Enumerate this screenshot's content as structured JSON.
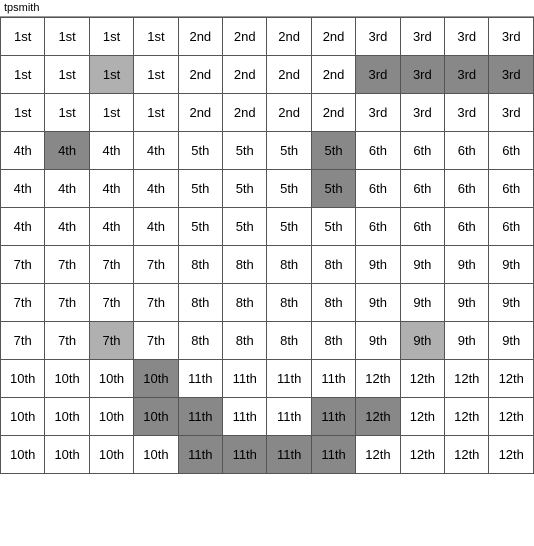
{
  "title": "tpsmith",
  "grid": {
    "rows": [
      [
        {
          "text": "1st",
          "bg": "normal"
        },
        {
          "text": "1st",
          "bg": "normal"
        },
        {
          "text": "1st",
          "bg": "normal"
        },
        {
          "text": "1st",
          "bg": "normal"
        },
        {
          "text": "2nd",
          "bg": "normal"
        },
        {
          "text": "2nd",
          "bg": "normal"
        },
        {
          "text": "2nd",
          "bg": "normal"
        },
        {
          "text": "2nd",
          "bg": "normal"
        },
        {
          "text": "3rd",
          "bg": "normal"
        },
        {
          "text": "3rd",
          "bg": "normal"
        },
        {
          "text": "3rd",
          "bg": "normal"
        },
        {
          "text": "3rd",
          "bg": "normal"
        }
      ],
      [
        {
          "text": "1st",
          "bg": "normal"
        },
        {
          "text": "1st",
          "bg": "normal"
        },
        {
          "text": "1st",
          "bg": "highlight"
        },
        {
          "text": "1st",
          "bg": "normal"
        },
        {
          "text": "2nd",
          "bg": "normal"
        },
        {
          "text": "2nd",
          "bg": "normal"
        },
        {
          "text": "2nd",
          "bg": "normal"
        },
        {
          "text": "2nd",
          "bg": "normal"
        },
        {
          "text": "3rd",
          "bg": "dark-highlight"
        },
        {
          "text": "3rd",
          "bg": "dark-highlight"
        },
        {
          "text": "3rd",
          "bg": "dark-highlight"
        },
        {
          "text": "3rd",
          "bg": "dark-highlight"
        }
      ],
      [
        {
          "text": "1st",
          "bg": "normal"
        },
        {
          "text": "1st",
          "bg": "normal"
        },
        {
          "text": "1st",
          "bg": "normal"
        },
        {
          "text": "1st",
          "bg": "normal"
        },
        {
          "text": "2nd",
          "bg": "normal"
        },
        {
          "text": "2nd",
          "bg": "normal"
        },
        {
          "text": "2nd",
          "bg": "normal"
        },
        {
          "text": "2nd",
          "bg": "normal"
        },
        {
          "text": "3rd",
          "bg": "normal"
        },
        {
          "text": "3rd",
          "bg": "normal"
        },
        {
          "text": "3rd",
          "bg": "normal"
        },
        {
          "text": "3rd",
          "bg": "normal"
        }
      ],
      [
        {
          "text": "4th",
          "bg": "normal"
        },
        {
          "text": "4th",
          "bg": "dark-highlight"
        },
        {
          "text": "4th",
          "bg": "normal"
        },
        {
          "text": "4th",
          "bg": "normal"
        },
        {
          "text": "5th",
          "bg": "normal"
        },
        {
          "text": "5th",
          "bg": "normal"
        },
        {
          "text": "5th",
          "bg": "normal"
        },
        {
          "text": "5th",
          "bg": "dark-highlight"
        },
        {
          "text": "6th",
          "bg": "normal"
        },
        {
          "text": "6th",
          "bg": "normal"
        },
        {
          "text": "6th",
          "bg": "normal"
        },
        {
          "text": "6th",
          "bg": "normal"
        }
      ],
      [
        {
          "text": "4th",
          "bg": "normal"
        },
        {
          "text": "4th",
          "bg": "normal"
        },
        {
          "text": "4th",
          "bg": "normal"
        },
        {
          "text": "4th",
          "bg": "normal"
        },
        {
          "text": "5th",
          "bg": "normal"
        },
        {
          "text": "5th",
          "bg": "normal"
        },
        {
          "text": "5th",
          "bg": "normal"
        },
        {
          "text": "5th",
          "bg": "dark-highlight"
        },
        {
          "text": "6th",
          "bg": "normal"
        },
        {
          "text": "6th",
          "bg": "normal"
        },
        {
          "text": "6th",
          "bg": "normal"
        },
        {
          "text": "6th",
          "bg": "normal"
        }
      ],
      [
        {
          "text": "4th",
          "bg": "normal"
        },
        {
          "text": "4th",
          "bg": "normal"
        },
        {
          "text": "4th",
          "bg": "normal"
        },
        {
          "text": "4th",
          "bg": "normal"
        },
        {
          "text": "5th",
          "bg": "normal"
        },
        {
          "text": "5th",
          "bg": "normal"
        },
        {
          "text": "5th",
          "bg": "normal"
        },
        {
          "text": "5th",
          "bg": "normal"
        },
        {
          "text": "6th",
          "bg": "normal"
        },
        {
          "text": "6th",
          "bg": "normal"
        },
        {
          "text": "6th",
          "bg": "normal"
        },
        {
          "text": "6th",
          "bg": "normal"
        }
      ],
      [
        {
          "text": "7th",
          "bg": "normal"
        },
        {
          "text": "7th",
          "bg": "normal"
        },
        {
          "text": "7th",
          "bg": "normal"
        },
        {
          "text": "7th",
          "bg": "normal"
        },
        {
          "text": "8th",
          "bg": "normal"
        },
        {
          "text": "8th",
          "bg": "normal"
        },
        {
          "text": "8th",
          "bg": "normal"
        },
        {
          "text": "8th",
          "bg": "normal"
        },
        {
          "text": "9th",
          "bg": "normal"
        },
        {
          "text": "9th",
          "bg": "normal"
        },
        {
          "text": "9th",
          "bg": "normal"
        },
        {
          "text": "9th",
          "bg": "normal"
        }
      ],
      [
        {
          "text": "7th",
          "bg": "normal"
        },
        {
          "text": "7th",
          "bg": "normal"
        },
        {
          "text": "7th",
          "bg": "normal"
        },
        {
          "text": "7th",
          "bg": "normal"
        },
        {
          "text": "8th",
          "bg": "normal"
        },
        {
          "text": "8th",
          "bg": "normal"
        },
        {
          "text": "8th",
          "bg": "normal"
        },
        {
          "text": "8th",
          "bg": "normal"
        },
        {
          "text": "9th",
          "bg": "normal"
        },
        {
          "text": "9th",
          "bg": "normal"
        },
        {
          "text": "9th",
          "bg": "normal"
        },
        {
          "text": "9th",
          "bg": "normal"
        }
      ],
      [
        {
          "text": "7th",
          "bg": "normal"
        },
        {
          "text": "7th",
          "bg": "normal"
        },
        {
          "text": "7th",
          "bg": "highlight"
        },
        {
          "text": "7th",
          "bg": "normal"
        },
        {
          "text": "8th",
          "bg": "normal"
        },
        {
          "text": "8th",
          "bg": "normal"
        },
        {
          "text": "8th",
          "bg": "normal"
        },
        {
          "text": "8th",
          "bg": "normal"
        },
        {
          "text": "9th",
          "bg": "normal"
        },
        {
          "text": "9th",
          "bg": "highlight"
        },
        {
          "text": "9th",
          "bg": "normal"
        },
        {
          "text": "9th",
          "bg": "normal"
        }
      ],
      [
        {
          "text": "10th",
          "bg": "normal"
        },
        {
          "text": "10th",
          "bg": "normal"
        },
        {
          "text": "10th",
          "bg": "normal"
        },
        {
          "text": "10th",
          "bg": "dark-highlight"
        },
        {
          "text": "11th",
          "bg": "normal"
        },
        {
          "text": "11th",
          "bg": "normal"
        },
        {
          "text": "11th",
          "bg": "normal"
        },
        {
          "text": "11th",
          "bg": "normal"
        },
        {
          "text": "12th",
          "bg": "normal"
        },
        {
          "text": "12th",
          "bg": "normal"
        },
        {
          "text": "12th",
          "bg": "normal"
        },
        {
          "text": "12th",
          "bg": "normal"
        }
      ],
      [
        {
          "text": "10th",
          "bg": "normal"
        },
        {
          "text": "10th",
          "bg": "normal"
        },
        {
          "text": "10th",
          "bg": "normal"
        },
        {
          "text": "10th",
          "bg": "dark-highlight"
        },
        {
          "text": "11th",
          "bg": "dark-highlight"
        },
        {
          "text": "11th",
          "bg": "normal"
        },
        {
          "text": "11th",
          "bg": "normal"
        },
        {
          "text": "11th",
          "bg": "dark-highlight"
        },
        {
          "text": "12th",
          "bg": "dark-highlight"
        },
        {
          "text": "12th",
          "bg": "normal"
        },
        {
          "text": "12th",
          "bg": "normal"
        },
        {
          "text": "12th",
          "bg": "normal"
        }
      ],
      [
        {
          "text": "10th",
          "bg": "normal"
        },
        {
          "text": "10th",
          "bg": "normal"
        },
        {
          "text": "10th",
          "bg": "normal"
        },
        {
          "text": "10th",
          "bg": "normal"
        },
        {
          "text": "11th",
          "bg": "dark-highlight"
        },
        {
          "text": "11th",
          "bg": "dark-highlight"
        },
        {
          "text": "11th",
          "bg": "dark-highlight"
        },
        {
          "text": "11th",
          "bg": "dark-highlight"
        },
        {
          "text": "12th",
          "bg": "normal"
        },
        {
          "text": "12th",
          "bg": "normal"
        },
        {
          "text": "12th",
          "bg": "normal"
        },
        {
          "text": "12th",
          "bg": "normal"
        }
      ]
    ]
  }
}
